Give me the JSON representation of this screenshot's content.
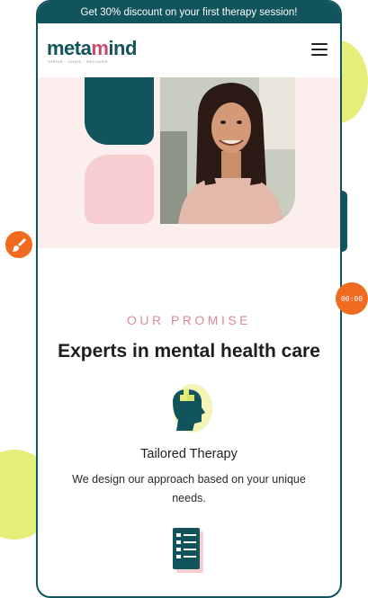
{
  "promo": {
    "text": "Get 30% discount on your first therapy session!"
  },
  "brand": {
    "name_start": "meta",
    "name_accent": "m",
    "name_end": "ind",
    "tagline": "THRIVE · UNITE · RECOVER"
  },
  "nav": {
    "menu_icon": "hamburger-icon"
  },
  "hero": {
    "photo_alt": "smiling woman",
    "fab_icon": "paintbrush-icon",
    "timer_text": "00:00"
  },
  "promise": {
    "eyebrow": "OUR PROMISE",
    "headline": "Experts in mental health care",
    "feature_icon": "head-puzzle-icon",
    "feature_title": "Tailored Therapy",
    "feature_desc": "We design our approach based on your unique needs.",
    "next_feature_icon": "checklist-icon"
  },
  "colors": {
    "brand_teal": "#11545b",
    "accent_pink": "#d98a95",
    "blob_yellow": "#e5ee78",
    "fab_orange": "#f06a1f",
    "hero_bg": "#fdeeee"
  }
}
